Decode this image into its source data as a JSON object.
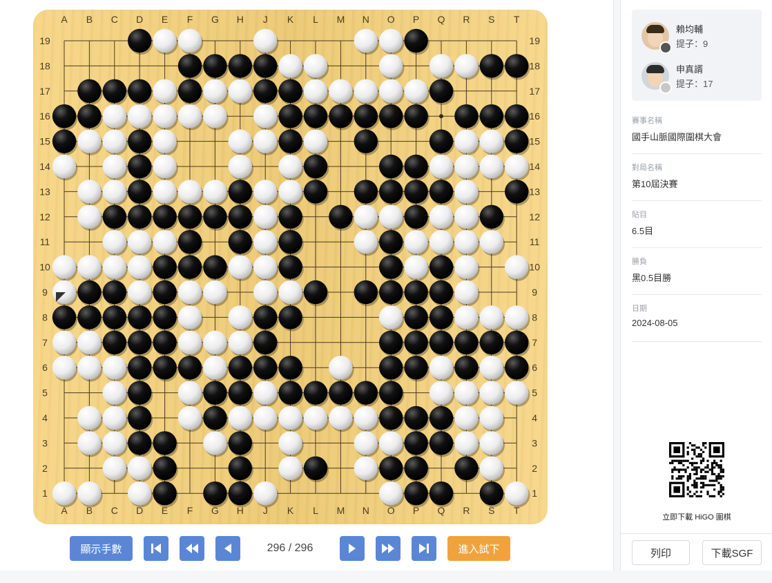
{
  "board": {
    "columns": [
      "A",
      "B",
      "C",
      "D",
      "E",
      "F",
      "G",
      "H",
      "J",
      "K",
      "L",
      "M",
      "N",
      "O",
      "P",
      "Q",
      "R",
      "S",
      "T"
    ],
    "rows": [
      "19",
      "18",
      "17",
      "16",
      "15",
      "14",
      "13",
      "12",
      "11",
      "10",
      "9",
      "8",
      "7",
      "6",
      "5",
      "4",
      "3",
      "2",
      "1"
    ],
    "stones": [
      "...BWW..W...WWB....",
      ".....BBBBWW..W.WWBB.",
      ".BBBWBWWBBWWWWWB...",
      "BBWWWWW.WBBBBBB.BBB",
      "BWWBW..WWBW.B..BWWB",
      "W.WBW..W.WB..BBWWWW",
      ".WWBWWWBWWB.BBBBW.B",
      ".WBBBBBBWB.BWWBWWB.",
      "..WWWB.BWB..WBWWWW.",
      "WWWWBBBWWB...BWBW.W.",
      "WBBWBWW.WWB.BBBBW..",
      "BBBBBW.WBB...WBBWWW",
      "WWBBBWWWB....BBBBBB",
      "WWWBBBWBBB.W.BBWBWB",
      "..WB.WBBWBBBBB.WWWW",
      ".WWB.WBWWWWWWBBBWW.",
      ".WWBB.WB.W..WWBBWW.",
      "..WWB..B.WB.WBB.BW.",
      "WW.WB.BBW....WBB.BW."
    ],
    "last_move": "A9",
    "star_point": "Q16"
  },
  "controls": {
    "show_moves_label": "顯示手數",
    "move_current": "296",
    "move_total": "296",
    "move_counter": "296 / 296",
    "try_label": "進入試下"
  },
  "players": [
    {
      "name": "賴均輔",
      "captures_label": "提子：9",
      "stone_color": "#555555"
    },
    {
      "name": "申真諝",
      "captures_label": "提子：17",
      "stone_color": "#c8c8c8"
    }
  ],
  "info": [
    {
      "label": "賽事名稱",
      "value": "國手山脈國際圍棋大會"
    },
    {
      "label": "對局名稱",
      "value": "第10屆決賽"
    },
    {
      "label": "貼目",
      "value": "6.5目"
    },
    {
      "label": "勝負",
      "value": "黑0.5目勝"
    },
    {
      "label": "日期",
      "value": "2024-08-05"
    }
  ],
  "qr_caption": "立即下載 HiGO 圍棋",
  "right_buttons": {
    "print_label": "列印",
    "download_label": "下載SGF"
  },
  "colors": {
    "accent_blue": "#5b86d6",
    "accent_orange": "#f0a33c",
    "board": "#f6d37d"
  }
}
